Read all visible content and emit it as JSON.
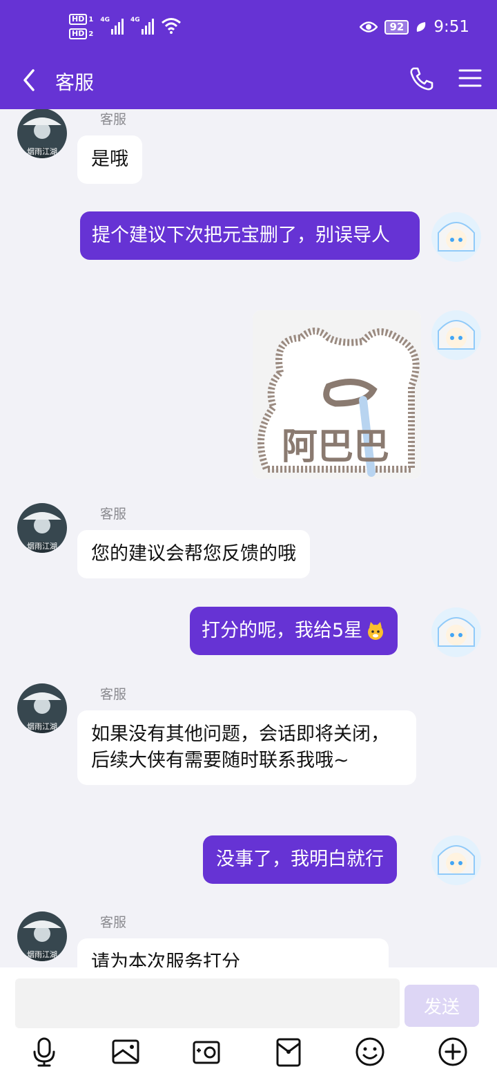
{
  "status_bar": {
    "time": "9:51",
    "battery": "92",
    "hd1": "HD",
    "hd2": "HD",
    "net1": "4G",
    "net2": "4G",
    "sim1": "1",
    "sim2": "2"
  },
  "header": {
    "title": "客服",
    "icons": [
      "back-arrow-icon",
      "phone-icon",
      "menu-icon"
    ]
  },
  "messages": [
    {
      "from": "agent",
      "sender": "客服",
      "text": "是哦"
    },
    {
      "from": "me",
      "text": "提个建议下次把元宝删了，别误导人"
    },
    {
      "from": "me",
      "sticker_text": "阿巴巴"
    },
    {
      "from": "agent",
      "sender": "客服",
      "text": "您的建议会帮您反馈的哦"
    },
    {
      "from": "me",
      "text": "打分的呢，我给5星"
    },
    {
      "from": "agent",
      "sender": "客服",
      "text": "如果没有其他问题，会话即将关闭，后续大侠有需要随时联系我哦~"
    },
    {
      "from": "me",
      "text": "没事了，我明白就行"
    },
    {
      "from": "agent",
      "sender": "客服",
      "text": "请为本次服务打分"
    }
  ],
  "agent_avatar_caption": "烟雨江湖",
  "composer": {
    "placeholder": "",
    "send_label": "发送"
  },
  "toolbar": [
    "microphone-icon",
    "image-icon",
    "camera-icon",
    "red-packet-icon",
    "emoji-icon",
    "add-icon"
  ],
  "colors": {
    "brand": "#6633d4",
    "bubble_in": "#ffffff",
    "background": "#f2f2f7",
    "send_disabled": "#ddd6f5"
  }
}
